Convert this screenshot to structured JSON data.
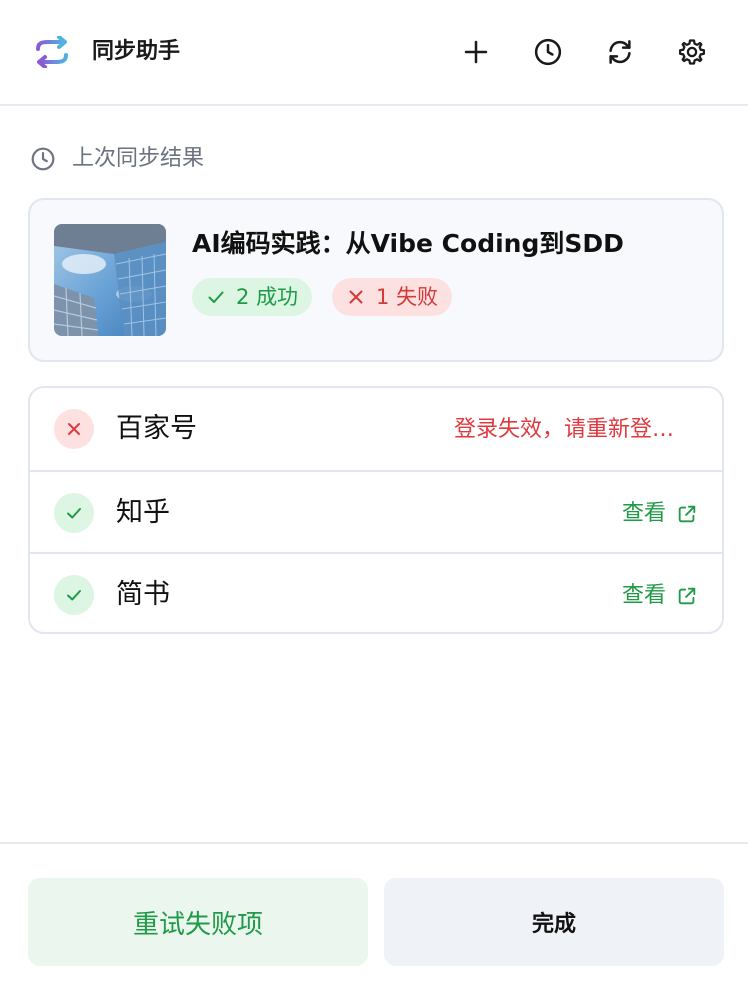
{
  "app": {
    "title": "同步助手"
  },
  "header": {
    "icons": [
      "add-icon",
      "history-icon",
      "sync-icon",
      "settings-icon"
    ]
  },
  "last_sync": {
    "label": "上次同步结果"
  },
  "article": {
    "title": "AI编码实践：从Vibe Coding到SDD",
    "success_count": "2",
    "success_label": "成功",
    "fail_count": "1",
    "fail_label": "失败"
  },
  "platforms": [
    {
      "name": "百家号",
      "status": "failed",
      "message": "登录失效，请重新登录后重试"
    },
    {
      "name": "知乎",
      "status": "success",
      "action": "查看"
    },
    {
      "name": "简书",
      "status": "success",
      "action": "查看"
    }
  ],
  "footer": {
    "retry_label": "重试失败项",
    "done_label": "完成"
  },
  "colors": {
    "success": "#1f9a46",
    "success_bg": "#dcf6e3",
    "error": "#e0393e",
    "error_bg": "#fde1e1",
    "muted": "#6b7280"
  }
}
